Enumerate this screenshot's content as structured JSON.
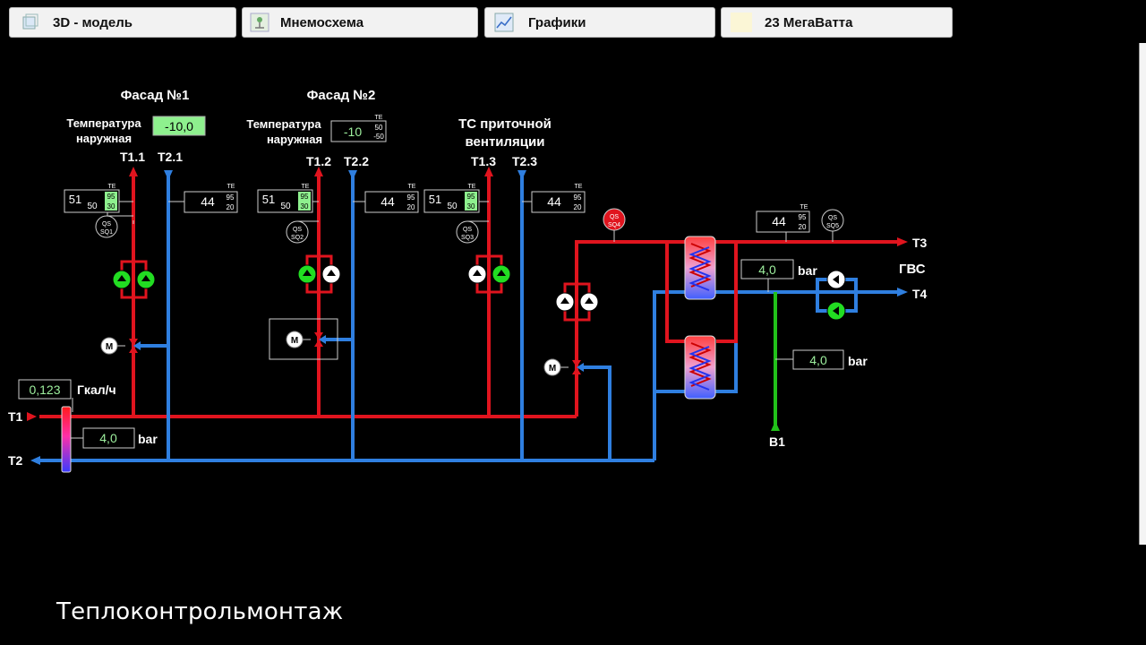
{
  "tabs": [
    {
      "label": "3D - модель",
      "icon": "cube-icon"
    },
    {
      "label": "Мнемосхема",
      "icon": "scheme-icon"
    },
    {
      "label": "Графики",
      "icon": "chart-icon"
    },
    {
      "label": "23 МегаВатта",
      "icon": "logo-icon"
    }
  ],
  "colors": {
    "supply": "#e0141e",
    "return": "#2f7fe0",
    "cold": "#22c21a",
    "pump": "#22dd22",
    "display_bg": "#8ef08e"
  },
  "facade1": {
    "title": "Фасад №1",
    "temp_label1": "Температура",
    "temp_label2": "наружная",
    "temp_value": "-10,0",
    "t1": "Т1.1",
    "t2": "Т2.1",
    "sup_value": "51",
    "sup_sp": "50",
    "sup_hi": "95",
    "sup_lo": "30",
    "sup_tag": "TE",
    "ret_value": "44",
    "ret_hi": "95",
    "ret_lo": "20",
    "ret_tag": "TE",
    "qs_top": "QS",
    "qs_bot": "SQ1",
    "valve": "M"
  },
  "facade2": {
    "title": "Фасад №2",
    "temp_label1": "Температура",
    "temp_label2": "наружная",
    "temp_value": "-10",
    "temp_tag": "TE",
    "temp_hi": "50",
    "temp_lo": "-50",
    "t1": "Т1.2",
    "t2": "Т2.2",
    "sup_value": "51",
    "sup_sp": "50",
    "sup_hi": "95",
    "sup_lo": "30",
    "sup_tag": "TE",
    "ret_value": "44",
    "ret_hi": "95",
    "ret_lo": "20",
    "ret_tag": "TE",
    "qs_top": "QS",
    "qs_bot": "SQ2",
    "valve": "M"
  },
  "vent": {
    "title1": "ТС приточной",
    "title2": "вентиляции",
    "t1": "Т1.3",
    "t2": "Т2.3",
    "sup_value": "51",
    "sup_sp": "50",
    "sup_hi": "95",
    "sup_lo": "30",
    "sup_tag": "TE",
    "ret_value": "44",
    "ret_hi": "95",
    "ret_lo": "20",
    "ret_tag": "TE",
    "qs_top": "QS",
    "qs_bot": "SQ3",
    "valve": "M"
  },
  "dhw": {
    "qs4_top": "QS",
    "qs4_bot": "SQ4",
    "qs5_top": "QS",
    "qs5_bot": "SQ5",
    "t3_value": "44",
    "t3_hi": "95",
    "t3_lo": "20",
    "t3_tag": "TE",
    "pressure1": "4,0",
    "pressure2": "4,0",
    "unit": "bar",
    "t3": "Т3",
    "t4": "Т4",
    "gvs": "ГВС",
    "b1": "В1",
    "valve": "M"
  },
  "main": {
    "heat_value": "0,123",
    "heat_unit": "Гкал/ч",
    "pressure": "4,0",
    "pressure_unit": "bar",
    "t1": "Т1",
    "t2": "Т2"
  },
  "watermark": "Теплоконтрольмонтаж"
}
